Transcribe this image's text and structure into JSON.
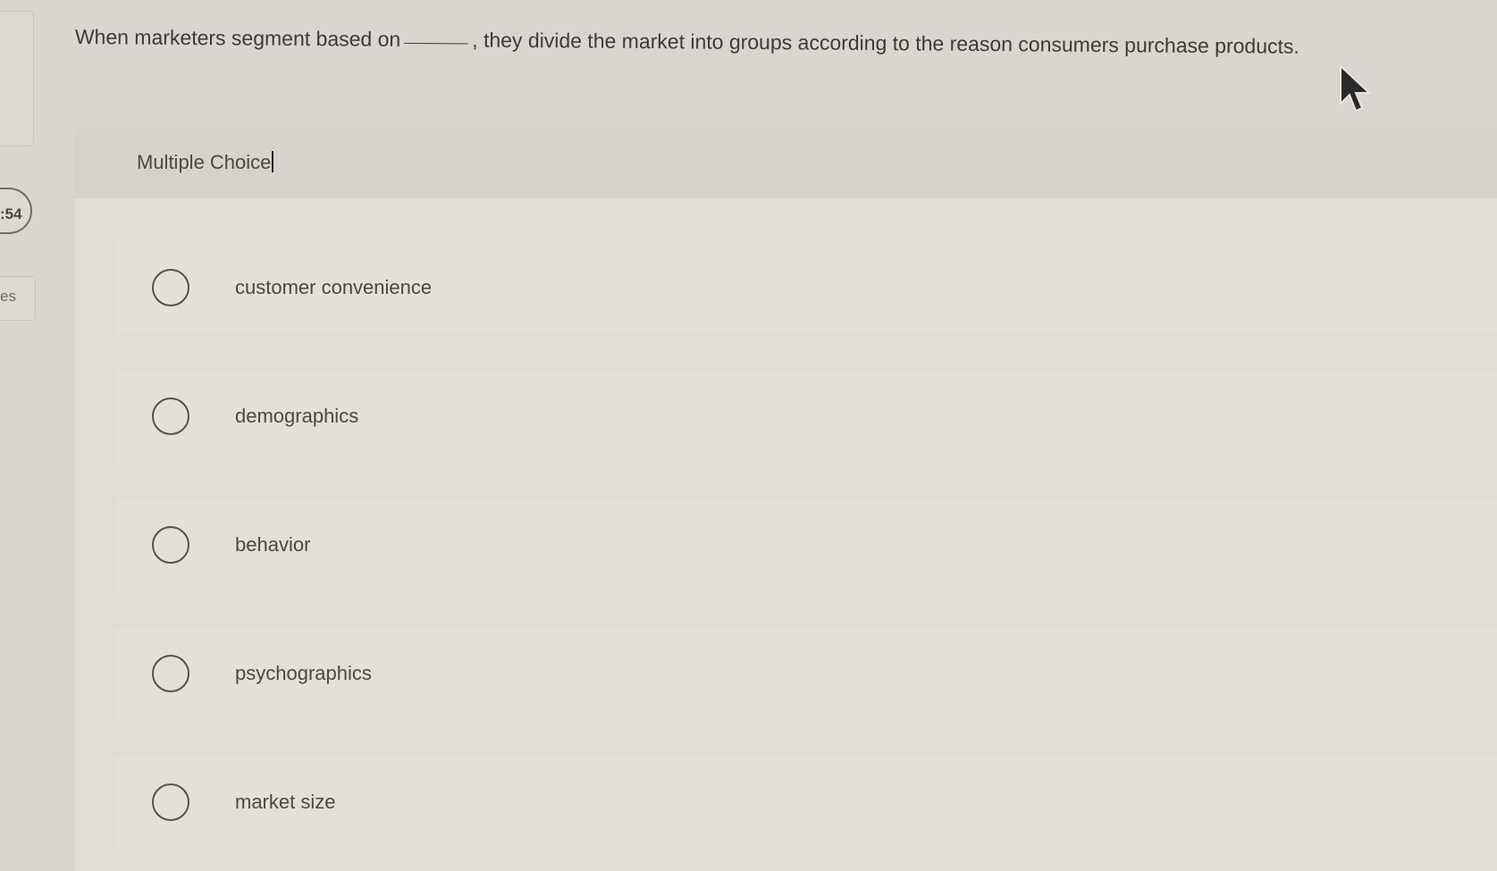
{
  "question": {
    "before_blank": "When marketers segment based on",
    "after_blank": ", they divide the market into groups according to the reason consumers purchase products."
  },
  "sidebar": {
    "timer_fragment": ":54",
    "label_fragment": "es"
  },
  "panel": {
    "type_label": "Multiple Choice"
  },
  "options": [
    {
      "label": "customer convenience"
    },
    {
      "label": "demographics"
    },
    {
      "label": "behavior"
    },
    {
      "label": "psychographics"
    },
    {
      "label": "market size"
    }
  ]
}
